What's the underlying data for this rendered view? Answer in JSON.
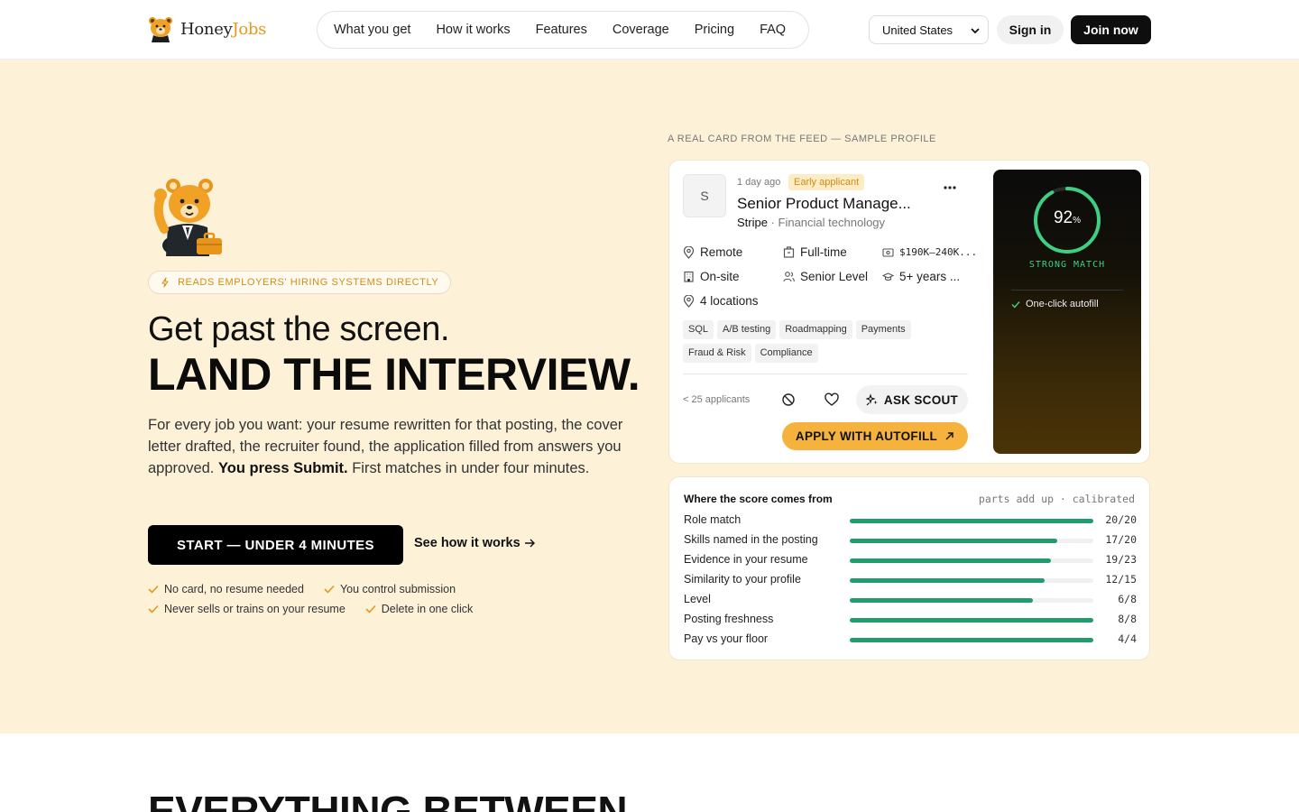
{
  "brand": {
    "name_part1": "Honey",
    "name_part2": "Jobs",
    "accent": "#e39a1f"
  },
  "nav": {
    "links": [
      "What you get",
      "How it works",
      "Features",
      "Coverage",
      "Pricing",
      "FAQ"
    ],
    "country": "United States",
    "signin": "Sign in",
    "join": "Join now"
  },
  "hero": {
    "badge": "READS EMPLOYERS' HIRING SYSTEMS DIRECTLY",
    "headline_1": "Get past the screen.",
    "headline_2": "LAND THE INTERVIEW.",
    "lede_part1": "For every job you want: your resume rewritten for that posting, the cover letter drafted, the recruiter found, the application filled from answers you approved. ",
    "lede_bold": "You press Submit.",
    "lede_part2": " First matches in under four minutes.",
    "cta": "START — UNDER 4 MINUTES",
    "see_how": "See how it works",
    "checks": [
      "No card, no resume needed",
      "You control submission",
      "Never sells or trains on your resume",
      "Delete in one click"
    ]
  },
  "job_card": {
    "kicker": "A REAL CARD FROM THE FEED — SAMPLE PROFILE",
    "logo_letter": "S",
    "posted": "1 day ago",
    "early_badge": "Early applicant",
    "title": "Senior Product Manage...",
    "company": "Stripe",
    "industry": " · Financial technology",
    "attributes": {
      "location": "Remote",
      "employment": "Full-time",
      "salary": "$190K–240K...",
      "workplace": "On-site",
      "level": "Senior Level",
      "experience": "5+ years ...",
      "locations": "4 locations"
    },
    "tags": [
      "SQL",
      "A/B testing",
      "Roadmapping",
      "Payments",
      "Fraud & Risk",
      "Compliance"
    ],
    "applicants": "< 25 applicants",
    "ask_scout": "ASK SCOUT",
    "apply": "APPLY WITH AUTOFILL",
    "match_percent": 92,
    "match_value": "92",
    "match_unit": "%",
    "match_label": "STRONG MATCH",
    "autofill_note": "One-click autofill"
  },
  "score": {
    "title": "Where the score comes from",
    "note": "parts add up · calibrated",
    "rows": [
      {
        "label": "Role match",
        "value": "20/20",
        "ratio": 1.0
      },
      {
        "label": "Skills named in the posting",
        "value": "17/20",
        "ratio": 0.85
      },
      {
        "label": "Evidence in your resume",
        "value": "19/23",
        "ratio": 0.826
      },
      {
        "label": "Similarity to your profile",
        "value": "12/15",
        "ratio": 0.8
      },
      {
        "label": "Level",
        "value": "6/8",
        "ratio": 0.75
      },
      {
        "label": "Posting freshness",
        "value": "8/8",
        "ratio": 1.0
      },
      {
        "label": "Pay vs your floor",
        "value": "4/4",
        "ratio": 1.0
      }
    ]
  },
  "next_section": {
    "heading": "EVERYTHING BETWEEN"
  }
}
